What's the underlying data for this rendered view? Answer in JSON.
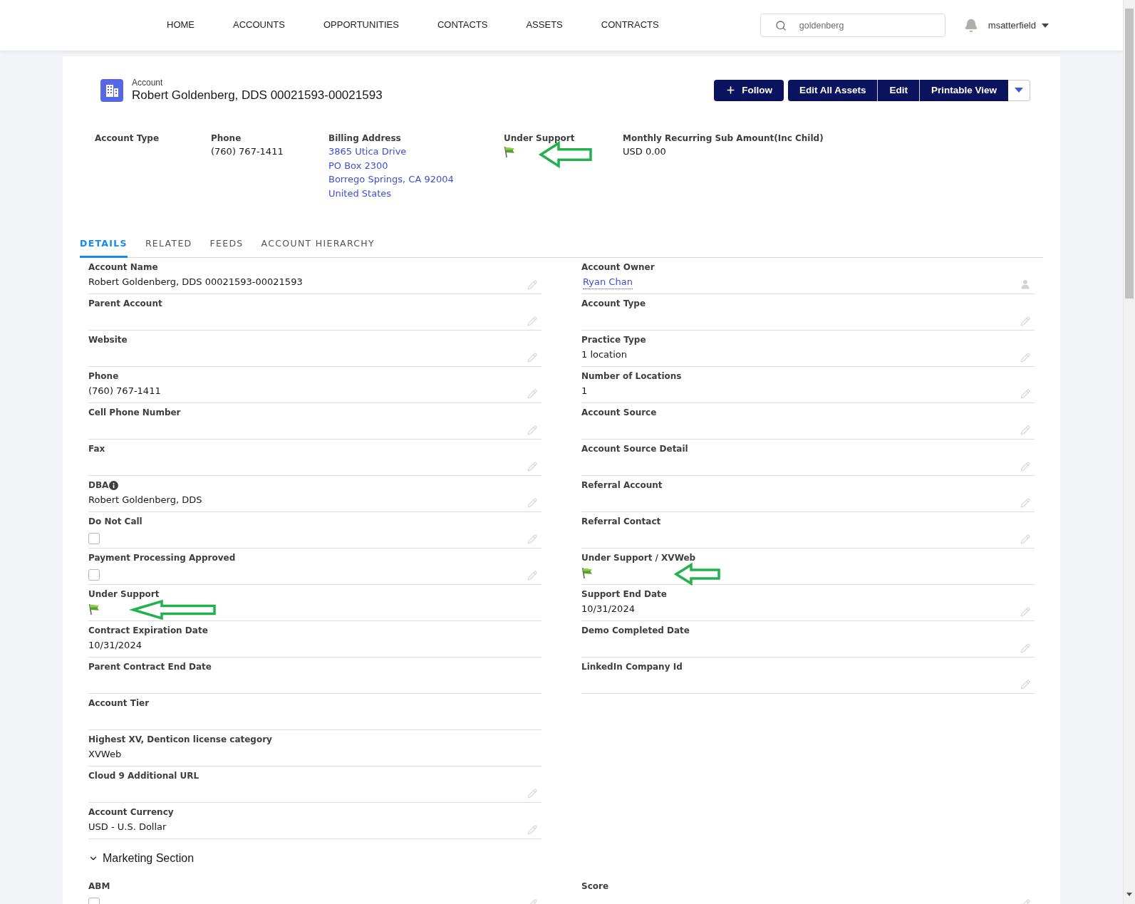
{
  "nav": {
    "links": [
      "HOME",
      "ACCOUNTS",
      "OPPORTUNITIES",
      "CONTACTS",
      "ASSETS",
      "CONTRACTS"
    ],
    "search": {
      "value": "goldenberg"
    },
    "user": "msatterfield"
  },
  "record": {
    "type": "Account",
    "title": "Robert Goldenberg, DDS 00021593-00021593",
    "follow": "Follow",
    "actions": [
      "Edit All Assets",
      "Edit",
      "Printable View"
    ]
  },
  "highlights": [
    {
      "kind": "text",
      "label": "Account Type"
    },
    {
      "kind": "text",
      "label": "Phone",
      "value": "(760) 767-1411"
    },
    {
      "kind": "address",
      "label": "Billing Address",
      "lines": [
        "3865 Utica Drive",
        "PO Box 2300",
        "Borrego Springs, CA 92004",
        "United States"
      ]
    },
    {
      "kind": "flag",
      "label": "Under Support",
      "on": true,
      "arrow": true
    },
    {
      "kind": "text",
      "label": "Monthly Recurring Sub Amount(Inc Child)",
      "value": "USD 0.00"
    }
  ],
  "tabs": [
    {
      "label": "DETAILS",
      "selected": true
    },
    {
      "label": "RELATED",
      "selected": false
    },
    {
      "label": "FEEDS",
      "selected": false
    },
    {
      "label": "ACCOUNT HIERARCHY",
      "selected": false
    }
  ],
  "details": {
    "left": [
      {
        "kind": "text",
        "label": "Account Name",
        "value": "Robert Goldenberg, DDS 00021593-00021593",
        "editable": true
      },
      {
        "kind": "text",
        "label": "Parent Account",
        "editable": true
      },
      {
        "kind": "text",
        "label": "Website",
        "editable": true
      },
      {
        "kind": "text",
        "label": "Phone",
        "value": "(760) 767-1411",
        "editable": true
      },
      {
        "kind": "text",
        "label": "Cell Phone Number",
        "editable": true
      },
      {
        "kind": "text",
        "label": "Fax",
        "editable": true
      },
      {
        "kind": "text",
        "label": "DBA",
        "help": true,
        "value": "Robert Goldenberg, DDS",
        "editable": true
      },
      {
        "kind": "checkbox",
        "label": "Do Not Call",
        "checked": false,
        "editable": true
      },
      {
        "kind": "checkbox",
        "label": "Payment Processing Approved",
        "checked": false,
        "editable": true
      },
      {
        "kind": "flag",
        "label": "Under Support",
        "on": true,
        "arrow": true,
        "editable": false
      },
      {
        "kind": "text",
        "label": "Contract Expiration Date",
        "value": "10/31/2024",
        "editable": false
      },
      {
        "kind": "text",
        "label": "Parent Contract End Date",
        "editable": false
      },
      {
        "kind": "text",
        "label": "Account Tier",
        "editable": false
      },
      {
        "kind": "text",
        "label": "Highest XV, Denticon license category",
        "value": "XVWeb",
        "editable": false
      },
      {
        "kind": "text",
        "label": "Cloud 9 Additional URL",
        "editable": true
      },
      {
        "kind": "text",
        "label": "Account Currency",
        "value": "USD - U.S. Dollar",
        "editable": true
      }
    ],
    "right": [
      {
        "kind": "owner",
        "label": "Account Owner",
        "value": "Ryan Chan",
        "editable": true
      },
      {
        "kind": "text",
        "label": "Account Type",
        "editable": true
      },
      {
        "kind": "text",
        "label": "Practice Type",
        "value": "1 location",
        "editable": true
      },
      {
        "kind": "text",
        "label": "Number of Locations",
        "value": "1",
        "editable": true
      },
      {
        "kind": "text",
        "label": "Account Source",
        "editable": true
      },
      {
        "kind": "text",
        "label": "Account Source Detail",
        "editable": true
      },
      {
        "kind": "text",
        "label": "Referral Account",
        "editable": true
      },
      {
        "kind": "text",
        "label": "Referral Contact",
        "editable": true
      },
      {
        "kind": "flag",
        "label": "Under Support / XVWeb",
        "on": true,
        "arrow": true,
        "editable": false
      },
      {
        "kind": "text",
        "label": "Support End Date",
        "value": "10/31/2024",
        "editable": true
      },
      {
        "kind": "text",
        "label": "Demo Completed Date",
        "editable": true
      },
      {
        "kind": "text",
        "label": "LinkedIn Company Id",
        "editable": true
      }
    ]
  },
  "sections": [
    {
      "title": "Marketing Section",
      "expanded": true,
      "left": [
        {
          "kind": "checkbox",
          "label": "ABM",
          "checked": false,
          "editable": true
        }
      ],
      "right": [
        {
          "kind": "text",
          "label": "Score",
          "editable": true
        }
      ]
    }
  ]
}
